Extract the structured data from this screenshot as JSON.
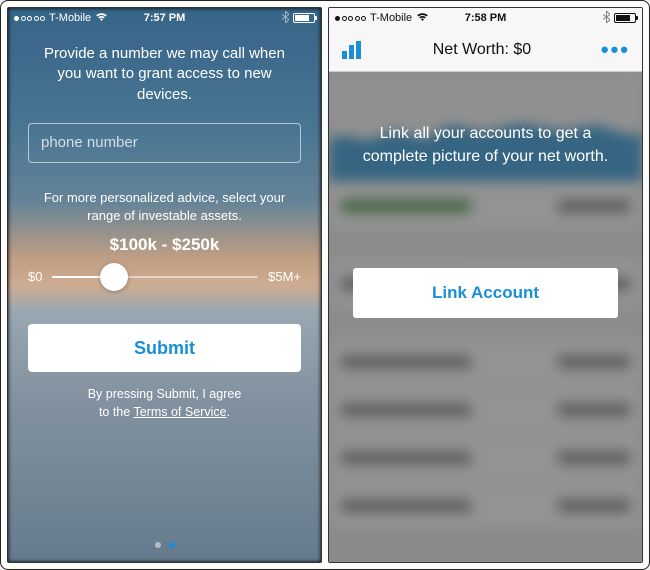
{
  "left": {
    "status": {
      "carrier": "T-Mobile",
      "time": "7:57 PM"
    },
    "instruction": "Provide a number we may call when you want to grant access to new devices.",
    "phone_placeholder": "phone number",
    "advice_text": "For more personalized advice, select your range of investable assets.",
    "range_value": "$100k - $250k",
    "slider_min": "$0",
    "slider_max": "$5M+",
    "submit_label": "Submit",
    "tos_prefix": "By pressing Submit, I agree",
    "tos_line2_pre": "to the ",
    "tos_link": "Terms of Service",
    "tos_suffix": "."
  },
  "right": {
    "status": {
      "carrier": "T-Mobile",
      "time": "7:58 PM"
    },
    "nav_title": "Net Worth: $0",
    "overlay_text": "Link all your accounts to get a complete picture of your net worth.",
    "link_label": "Link Account"
  }
}
